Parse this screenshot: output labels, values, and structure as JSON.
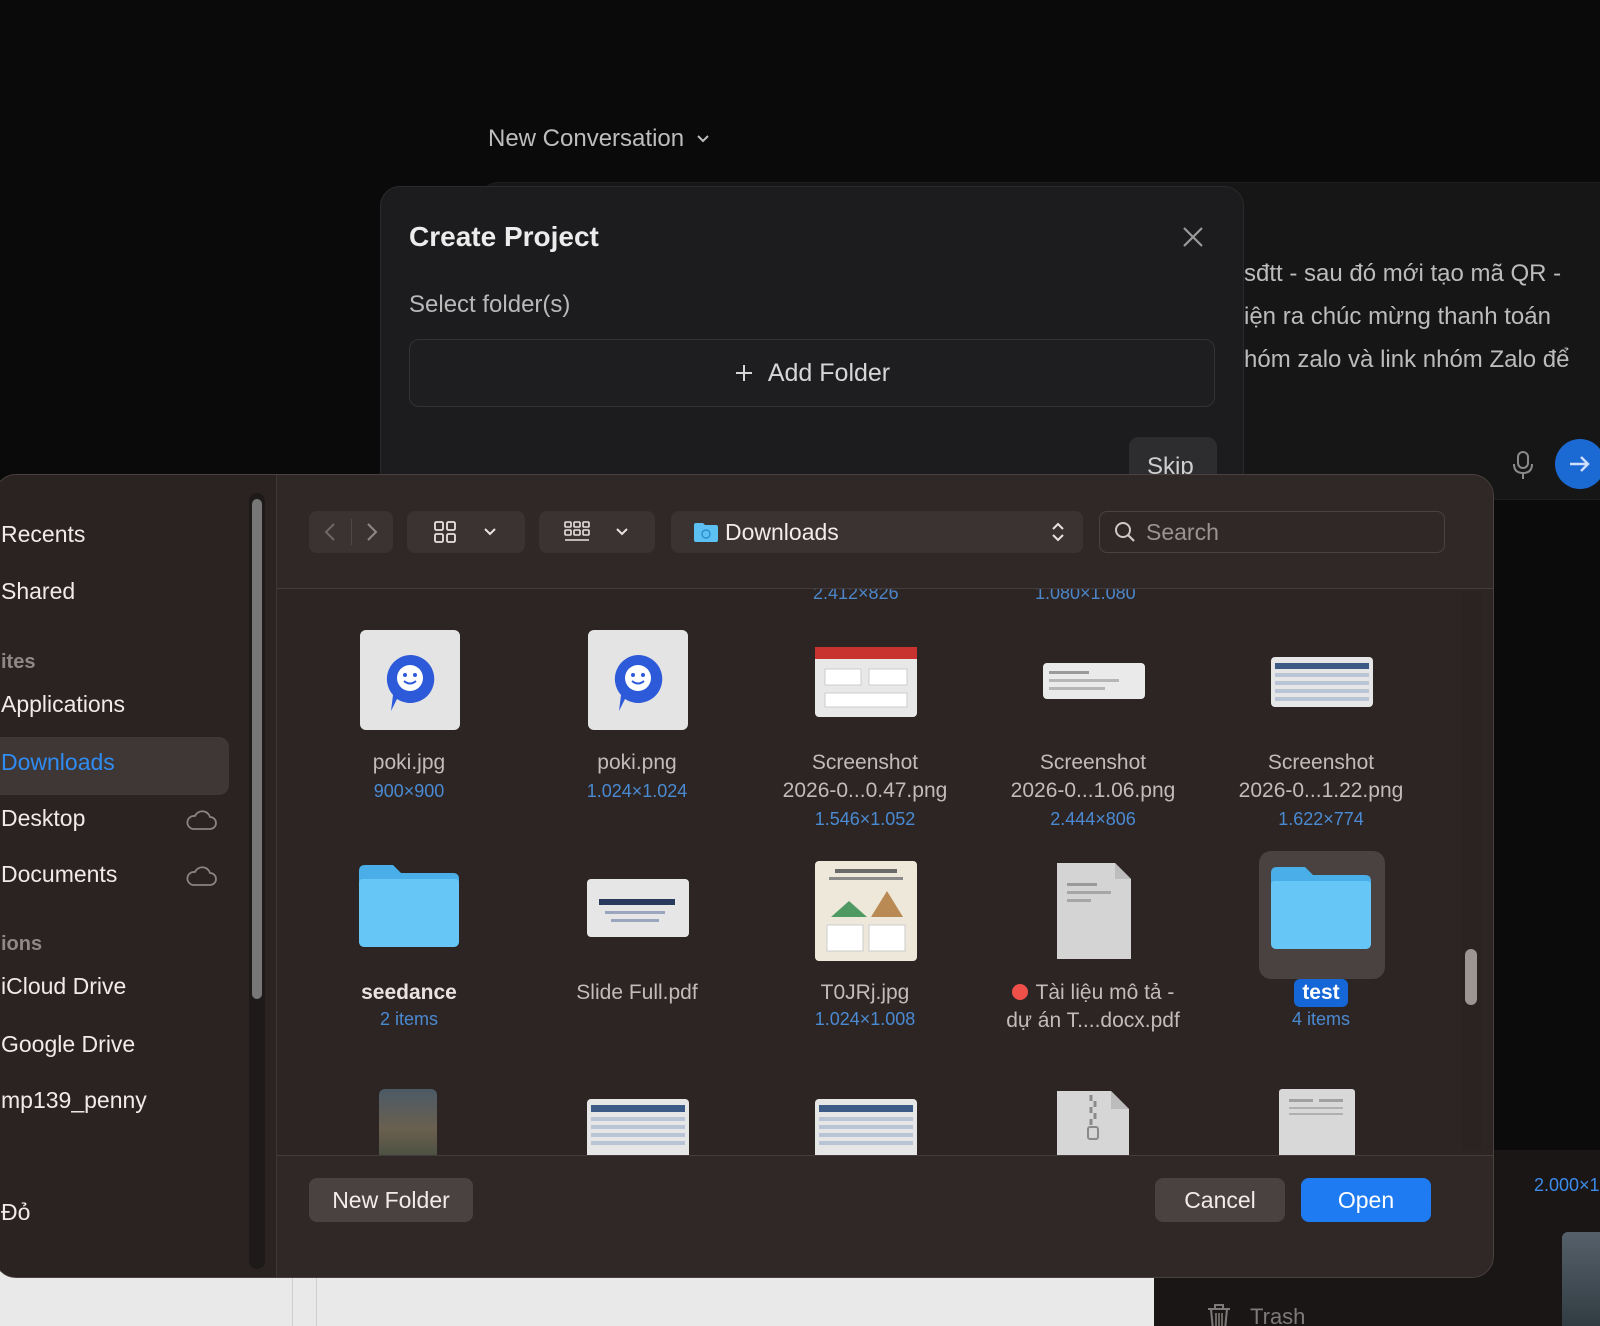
{
  "background": {
    "conversation_title": "New Conversation",
    "chat_lines": [
      "sđtt - sau đó mới tạo mã QR -",
      "iện ra chúc mừng thanh toán",
      "hóm zalo và link nhóm Zalo để"
    ],
    "modal": {
      "title": "Create Project",
      "subtitle": "Select folder(s)",
      "add_folder_label": "Add Folder",
      "skip_label": "Skip"
    },
    "partial_size": "2.000×1",
    "trash_label": "Trash"
  },
  "sidebar": {
    "items": [
      {
        "label": "Recents"
      },
      {
        "label": "Shared"
      },
      {
        "label": "ites",
        "kind": "header"
      },
      {
        "label": "Applications"
      },
      {
        "label": "Downloads",
        "selected": true
      },
      {
        "label": "Desktop",
        "cloud": true
      },
      {
        "label": "Documents",
        "cloud": true
      },
      {
        "label": "ions",
        "kind": "header"
      },
      {
        "label": "iCloud Drive"
      },
      {
        "label": "Google Drive"
      },
      {
        "label": "mp139_penny"
      },
      {
        "label": "Đỏ"
      }
    ]
  },
  "toolbar": {
    "location": "Downloads",
    "search_placeholder": "Search"
  },
  "files": {
    "cut_meta": [
      "2.412×826",
      "1.080×1.080"
    ],
    "row1": [
      {
        "name": "poki.jpg",
        "meta": "900×900"
      },
      {
        "name": "poki.png",
        "meta": "1.024×1.024"
      },
      {
        "name_line1": "Screenshot",
        "name_line2": "2026-0...0.47.png",
        "meta": "1.546×1.052"
      },
      {
        "name_line1": "Screenshot",
        "name_line2": "2026-0...1.06.png",
        "meta": "2.444×806"
      },
      {
        "name_line1": "Screenshot",
        "name_line2": "2026-0...1.22.png",
        "meta": "1.622×774"
      }
    ],
    "row2": [
      {
        "name": "seedance",
        "meta": "2 items"
      },
      {
        "name": "Slide Full.pdf"
      },
      {
        "name": "T0JRj.jpg",
        "meta": "1.024×1.008"
      },
      {
        "name_line1": "Tài liệu mô tả -",
        "name_line2": "dự án T....docx.pdf",
        "tag_color": "#f0504a"
      },
      {
        "name": "test",
        "meta": "4 items",
        "selected": true
      }
    ]
  },
  "footer": {
    "new_folder_label": "New Folder",
    "cancel_label": "Cancel",
    "open_label": "Open"
  },
  "colors": {
    "accent_blue": "#1e7bf2",
    "folder_blue": "#5cc0f3",
    "meta_blue": "#4a8ad2",
    "tag_red": "#f0504a"
  }
}
